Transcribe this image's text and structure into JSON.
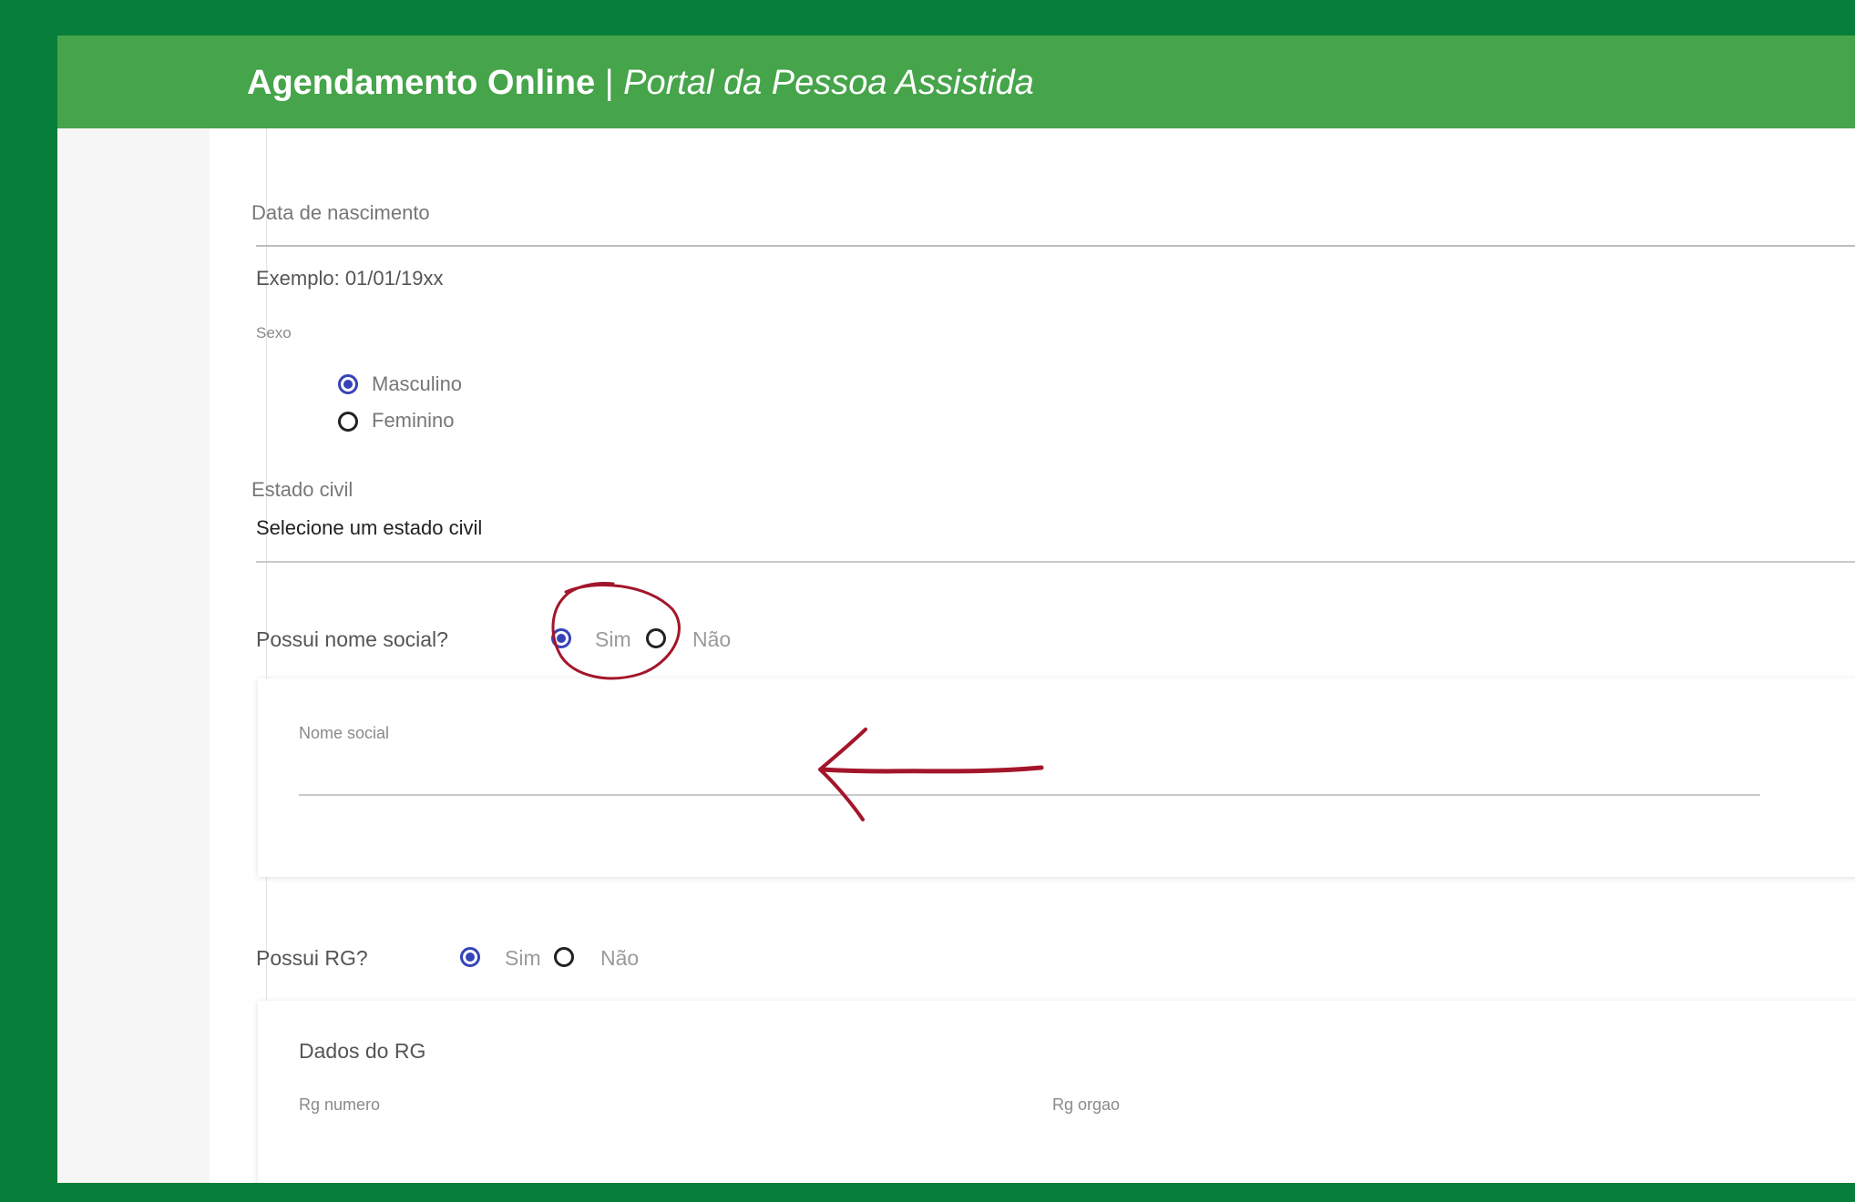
{
  "header": {
    "brand": "Agendamento Online",
    "separator": "|",
    "subtitle": "Portal da Pessoa Assistida"
  },
  "form": {
    "birthdate": {
      "label": "Data de nascimento",
      "hint": "Exemplo: 01/01/19xx"
    },
    "sex": {
      "label": "Sexo",
      "options": [
        "Masculino",
        "Feminino"
      ],
      "selected": "Masculino"
    },
    "civil_status": {
      "label": "Estado civil",
      "value": "Selecione um estado civil"
    },
    "social_name_question": {
      "label": "Possui nome social?",
      "yes": "Sim",
      "no": "Não",
      "selected": "Sim"
    },
    "social_name_card": {
      "label": "Nome social",
      "value": ""
    },
    "rg_question": {
      "label": "Possui RG?",
      "yes": "Sim",
      "no": "Não",
      "selected": "Sim"
    },
    "rg_card": {
      "title": "Dados do RG",
      "number_label": "Rg numero",
      "org_label": "Rg orgao"
    }
  },
  "annotation": {
    "color": "#a3162a"
  },
  "colors": {
    "frame": "#077f3a",
    "header": "#46a44a",
    "radio_selected": "#3643b8"
  }
}
